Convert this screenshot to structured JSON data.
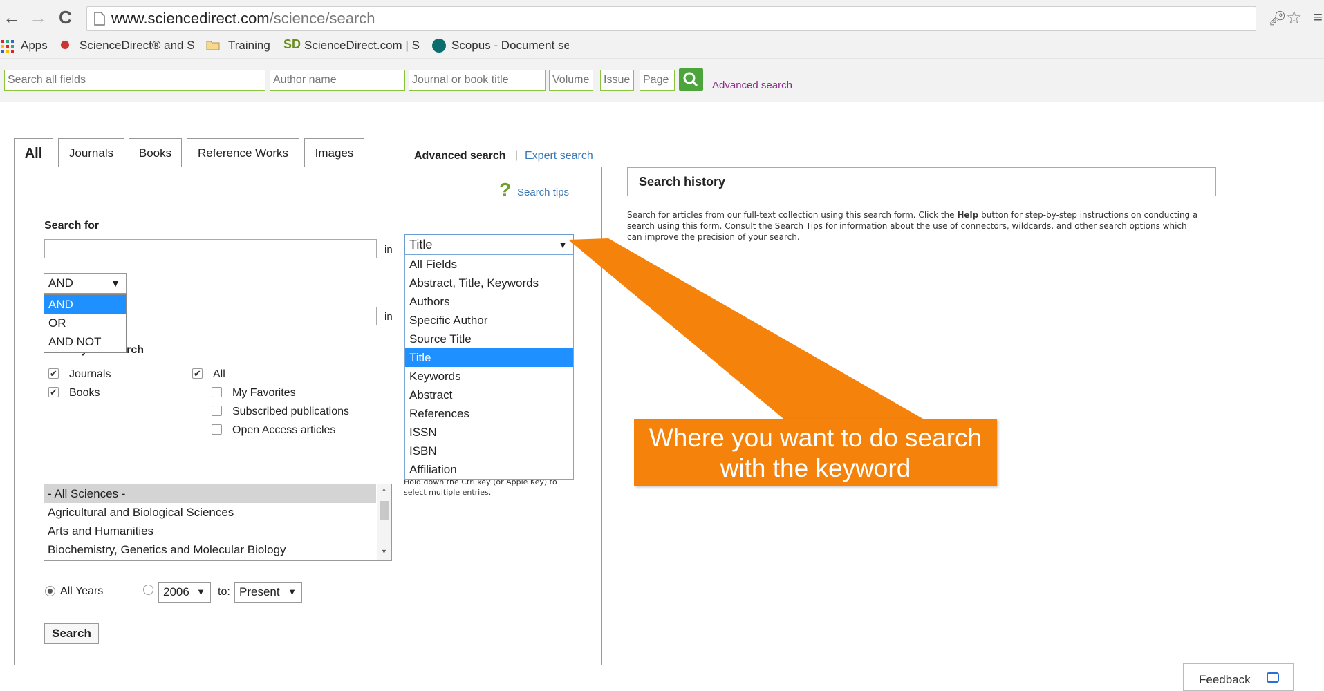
{
  "browser": {
    "url_host": "www.sciencedirect.com",
    "url_path": "/science/search",
    "bookmarks": [
      "Apps",
      "ScienceDirect® and S",
      "Training",
      "ScienceDirect.com | Sc",
      "Scopus - Document se"
    ]
  },
  "quick_search": {
    "all_fields_placeholder": "Search all fields",
    "author_placeholder": "Author name",
    "journal_placeholder": "Journal or book title",
    "volume_placeholder": "Volume",
    "issue_placeholder": "Issue",
    "page_placeholder": "Page",
    "advanced_link": "Advanced search"
  },
  "tabs": [
    "All",
    "Journals",
    "Books",
    "Reference Works",
    "Images"
  ],
  "search_mode": {
    "advanced": "Advanced search",
    "separator": "|",
    "expert": "Expert search"
  },
  "search_tips": "Search tips",
  "form": {
    "search_for_label": "Search for",
    "in_label": "in",
    "field_selected": "Title",
    "field_options": [
      "All Fields",
      "Abstract, Title, Keywords",
      "Authors",
      "Specific Author",
      "Source Title",
      "Title",
      "Keywords",
      "Abstract",
      "References",
      "ISSN",
      "ISBN",
      "Affiliation"
    ],
    "field_highlighted_index": 5,
    "connector_selected": "AND",
    "connector_options": [
      "AND",
      "OR",
      "AND NOT"
    ],
    "refine_label": "Refine your search",
    "sources": [
      {
        "label": "Journals",
        "checked": true
      },
      {
        "label": "Books",
        "checked": true
      }
    ],
    "access": [
      {
        "label": "All",
        "checked": true
      },
      {
        "label": "My Favorites",
        "checked": false
      },
      {
        "label": "Subscribed publications",
        "checked": false
      },
      {
        "label": "Open Access articles",
        "checked": false
      }
    ],
    "ctrl_hint": "Hold down the Ctrl key (or Apple Key) to select multiple entries.",
    "subjects": [
      "- All Sciences -",
      "Agricultural and Biological Sciences",
      "Arts and Humanities",
      "Biochemistry, Genetics and Molecular Biology"
    ],
    "years_all_label": "All Years",
    "year_from": "2006",
    "to_label": "to:",
    "year_to": "Present",
    "search_button": "Search"
  },
  "history": {
    "title": "Search history",
    "intro_before": "Search for articles from our full-text collection using this search form. Click the",
    "help_word": "Help",
    "intro_after": "button for step-by-step instructions on conducting a search using this form. Consult the Search Tips for information about the use of connectors, wildcards, and other search options which can improve the precision of your search."
  },
  "callout": {
    "text": "Where you want to do search with the keyword",
    "color": "#f5820b"
  },
  "feedback": "Feedback",
  "colors": {
    "accent_green": "#8bc53f",
    "highlight_blue": "#1e90ff",
    "link_purple": "#8b2a8b",
    "link_blue": "#3a78b5"
  }
}
